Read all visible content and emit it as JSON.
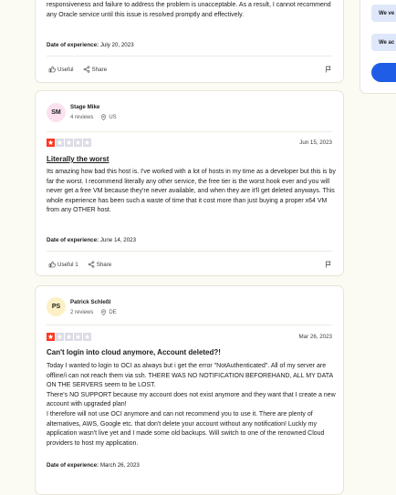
{
  "reviews": [
    {
      "body": "responsiveness and failure to address the problem is unacceptable. As a result, I cannot recommend any Oracle service until this issue is resolved promptly and effectively.",
      "doe_label": "Date of experience:",
      "doe_value": "July 20, 2023",
      "useful_label": "Useful",
      "share_label": "Share"
    },
    {
      "initials": "SM",
      "avatar_color": "#fbe1f0",
      "name": "Stage Mike",
      "reviews_count": "4 reviews",
      "country": "US",
      "rating": 1,
      "date": "Jun 15, 2023",
      "title": "Literally the worst",
      "body": "Its amazing how bad this host is. I've worked with a lot of hosts in my time as a developer but this is by far the worst. I recommend literally any other service, the free tier is the worst hook ever and you will never get a free VM because they're never available, and when they are it'll get deleted anyways. This whole experience has been such a waste of time that it cost more than just buying a proper x64 VM from any OTHER host.",
      "doe_label": "Date of experience:",
      "doe_value": "June 14, 2023",
      "useful_label": "Useful 1",
      "share_label": "Share"
    },
    {
      "initials": "PS",
      "avatar_color": "#fcf0c4",
      "name": "Patrick Schleßl",
      "reviews_count": "2 reviews",
      "country": "DE",
      "rating": 1,
      "date": "Mar 26, 2023",
      "title": "Can't login into cloud anymore, Account deleted?!",
      "body": "Today I wanted to login to OCI as always but i get the error \"NotAuthenticated\". All of my server are offline/i can not reach them via ssh. THERE WAS NO NOTIFICATION BEFOREHAND, ALL MY DATA ON THE SERVERS seem to be LOST.\nThere's NO SUPPORT because my account does not exist anymore and they want that I create a new account with upgraded plan!\nI therefore will not use OCI anymore and can not recommend you to use it. There are plenty of alternatives, AWS, Google etc. that don't delete your account without any notification! Luckly my application wasn't live yet and I made some old backups. Will switch to one of the renowned Cloud providers to host my application.",
      "doe_label": "Date of experience:",
      "doe_value": "March 26, 2023"
    }
  ],
  "sidebar": {
    "pill1": "We ve",
    "pill2": "We ac"
  },
  "colors": {
    "star_on": "#ff3722",
    "star_off": "#dcdce6",
    "button": "#1f5de6"
  }
}
